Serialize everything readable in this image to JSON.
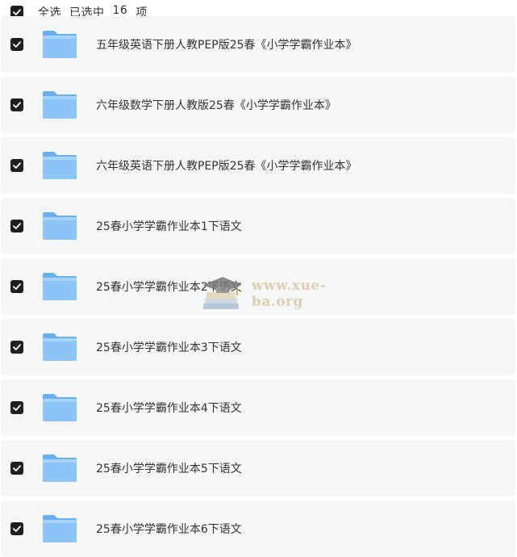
{
  "header": {
    "select_all_label": "全选",
    "selected_prefix": "已选中",
    "selected_count": "16",
    "selected_suffix": "项"
  },
  "rows": [
    {
      "name": "五年级英语下册人教PEP版25春《小学学霸作业本》"
    },
    {
      "name": "六年级数学下册人教版25春《小学学霸作业本》"
    },
    {
      "name": "六年级英语下册人教PEP版25春《小学学霸作业本》"
    },
    {
      "name": "25春小学学霸作业本1下语文"
    },
    {
      "name": "25春小学学霸作业本2下语文"
    },
    {
      "name": "25春小学学霸作业本3下语文"
    },
    {
      "name": "25春小学学霸作业本4下语文"
    },
    {
      "name": "25春小学学霸作业本5下语文"
    },
    {
      "name": "25春小学学霸作业本6下语文"
    }
  ],
  "watermark": {
    "text": "www.xue-ba.org"
  },
  "icons": {
    "checkbox": "checkbox-checked-icon",
    "folder": "folder-icon"
  },
  "colors": {
    "checkbox": "#1f1f1f",
    "row_bg": "#f5f6f7",
    "folder_front": "#8ec5f7",
    "folder_back": "#6aaff0",
    "text": "#333333"
  }
}
